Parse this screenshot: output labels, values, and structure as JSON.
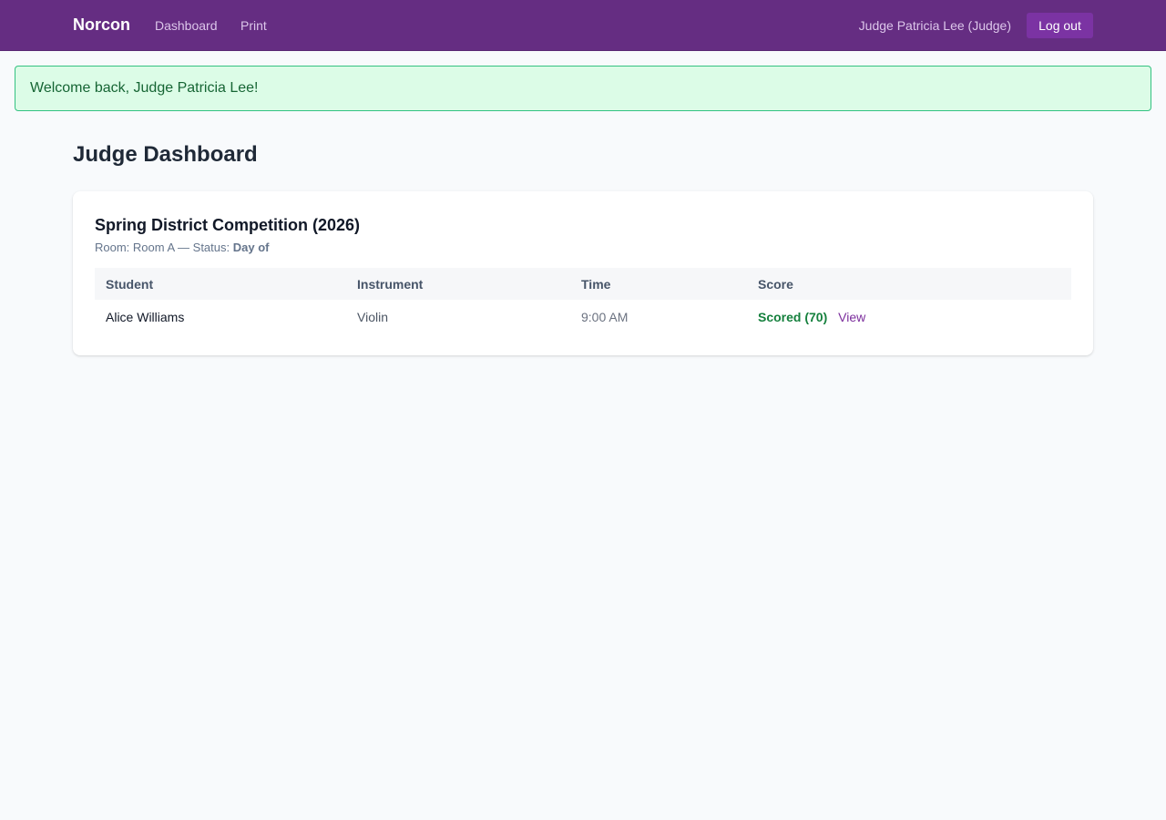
{
  "nav": {
    "brand": "Norcon",
    "links": [
      "Dashboard",
      "Print"
    ],
    "user_label": "Judge Patricia Lee (Judge)",
    "logout_label": "Log out"
  },
  "flash": {
    "message": "Welcome back, Judge Patricia Lee!"
  },
  "page": {
    "title": "Judge Dashboard"
  },
  "competition": {
    "title": "Spring District Competition (2026)",
    "room_prefix": "Room: Room A — Status: ",
    "status": "Day of",
    "table": {
      "headers": [
        "Student",
        "Instrument",
        "Time",
        "Score"
      ],
      "rows": [
        {
          "student": "Alice Williams",
          "instrument": "Violin",
          "time": "9:00 AM",
          "score": "Scored (70)",
          "action": "View"
        }
      ]
    }
  },
  "colors": {
    "topbar": "#652d82",
    "accent": "#7b33a3",
    "success_bg": "#dcfce7",
    "success_border": "#34c281",
    "success_text": "#15803d",
    "link": "#7b2d9c",
    "page_bg": "#f8fafc"
  }
}
